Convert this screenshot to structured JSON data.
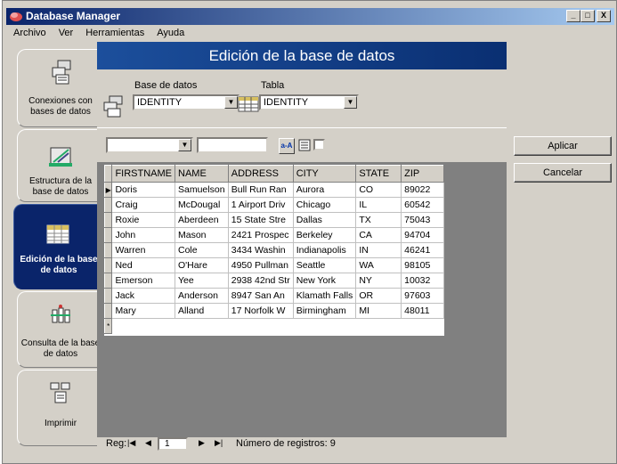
{
  "window": {
    "title": "Database Manager",
    "min": "_",
    "max": "□",
    "close": "X"
  },
  "menu": [
    {
      "label": "Archivo"
    },
    {
      "label": "Ver"
    },
    {
      "label": "Herramientas"
    },
    {
      "label": "Ayuda"
    }
  ],
  "sidebar": {
    "items": [
      {
        "label": "Conexiones con bases de datos",
        "icon": "database-connection-icon",
        "active": false
      },
      {
        "label": "Estructura de la base de datos",
        "icon": "design-icon",
        "active": false
      },
      {
        "label": "Edición de la base de datos",
        "icon": "table-edit-icon",
        "active": true
      },
      {
        "label": "Consulta de la base de datos",
        "icon": "query-icon",
        "active": false
      },
      {
        "label": "Imprimir",
        "icon": "print-icon",
        "active": false
      }
    ]
  },
  "header": {
    "title": "Edición de la base de datos"
  },
  "selectors": {
    "database_label": "Base de datos",
    "database_value": "IDENTITY",
    "table_label": "Tabla",
    "table_value": "IDENTITY"
  },
  "toolbar": {
    "sort_label": "a-A"
  },
  "grid": {
    "columns": [
      "FIRSTNAME",
      "NAME",
      "ADDRESS",
      "CITY",
      "STATE",
      "ZIP"
    ],
    "rows": [
      [
        "Doris",
        "Samuelson",
        "Bull Run Ran",
        "Aurora",
        "CO",
        "89022"
      ],
      [
        "Craig",
        "McDougal",
        "1 Airport Driv",
        "Chicago",
        "IL",
        "60542"
      ],
      [
        "Roxie",
        "Aberdeen",
        "15 State Stre",
        "Dallas",
        "TX",
        "75043"
      ],
      [
        "John",
        "Mason",
        "2421 Prospec",
        "Berkeley",
        "CA",
        "94704"
      ],
      [
        "Warren",
        "Cole",
        "3434 Washin",
        "Indianapolis",
        "IN",
        "46241"
      ],
      [
        "Ned",
        "O'Hare",
        "4950 Pullman",
        "Seattle",
        "WA",
        "98105"
      ],
      [
        "Emerson",
        "Yee",
        "2938 42nd Str",
        "New York",
        "NY",
        "10032"
      ],
      [
        "Jack",
        "Anderson",
        "8947 San An",
        "Klamath Falls",
        "OR",
        "97603"
      ],
      [
        "Mary",
        "Alland",
        "17 Norfolk W",
        "Birmingham",
        "MI",
        "48011"
      ]
    ],
    "current_marker": "▶",
    "new_marker": "*"
  },
  "record_nav": {
    "label": "Reg:",
    "current": "1",
    "count_text": "Número de registros: 9"
  },
  "actions": {
    "apply": "Aplicar",
    "cancel": "Cancelar"
  }
}
